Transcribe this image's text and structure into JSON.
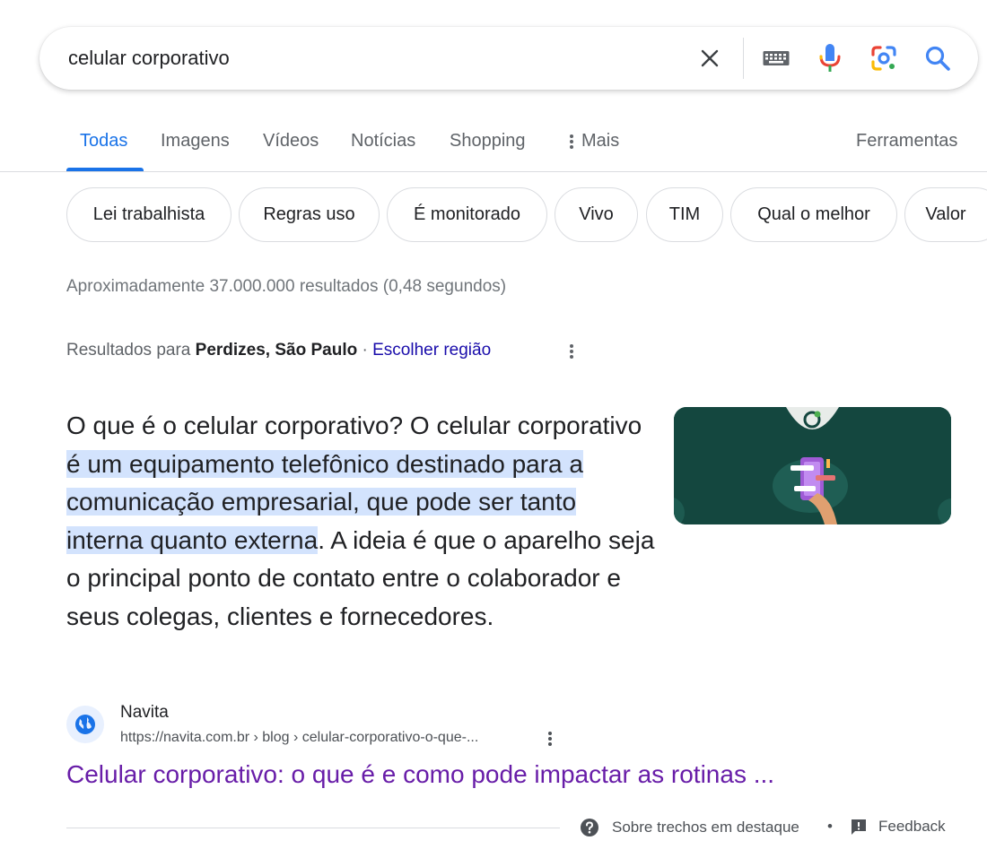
{
  "search": {
    "query": "celular corporativo",
    "icons": [
      "close-icon",
      "keyboard-icon",
      "microphone-icon",
      "lens-icon",
      "search-icon"
    ]
  },
  "tabs": [
    {
      "label": "Todas",
      "active": true
    },
    {
      "label": "Imagens"
    },
    {
      "label": "Vídeos"
    },
    {
      "label": "Notícias"
    },
    {
      "label": "Shopping"
    },
    {
      "label": "Mais"
    },
    {
      "label": "Ferramentas"
    }
  ],
  "chips": [
    "Lei trabalhista",
    "Regras uso",
    "É monitorado",
    "Vivo",
    "TIM",
    "Qual o melhor",
    "Valor"
  ],
  "stats": "Aproximadamente 37.000.000 resultados (0,48 segundos)",
  "region": {
    "prefix": "Resultados para",
    "place": "Perdizes, São Paulo",
    "sep": "·",
    "link": "Escolher região"
  },
  "snippet": {
    "before": "O que é o celular corporativo? O celular corporativo ",
    "highlight": "é um equipamento telefônico destinado para a comunicação empresarial, que pode ser tanto interna quanto externa",
    "after": ". A ideia é que o aparelho seja o principal ponto de contato entre o colaborador e seus colegas, clientes e fornecedores."
  },
  "source": {
    "name": "Navita",
    "url": "https://navita.com.br › blog › celular-corporativo-o-que-...",
    "title": "Celular corporativo: o que é e como pode impactar as rotinas ..."
  },
  "footer": {
    "about": "Sobre trechos em destaque",
    "dot": "•",
    "feedback": "Feedback"
  },
  "colors": {
    "accent": "#1a73e8",
    "visited_link": "#681da8",
    "link": "#1a0dab",
    "highlight": "#d3e3fd"
  }
}
